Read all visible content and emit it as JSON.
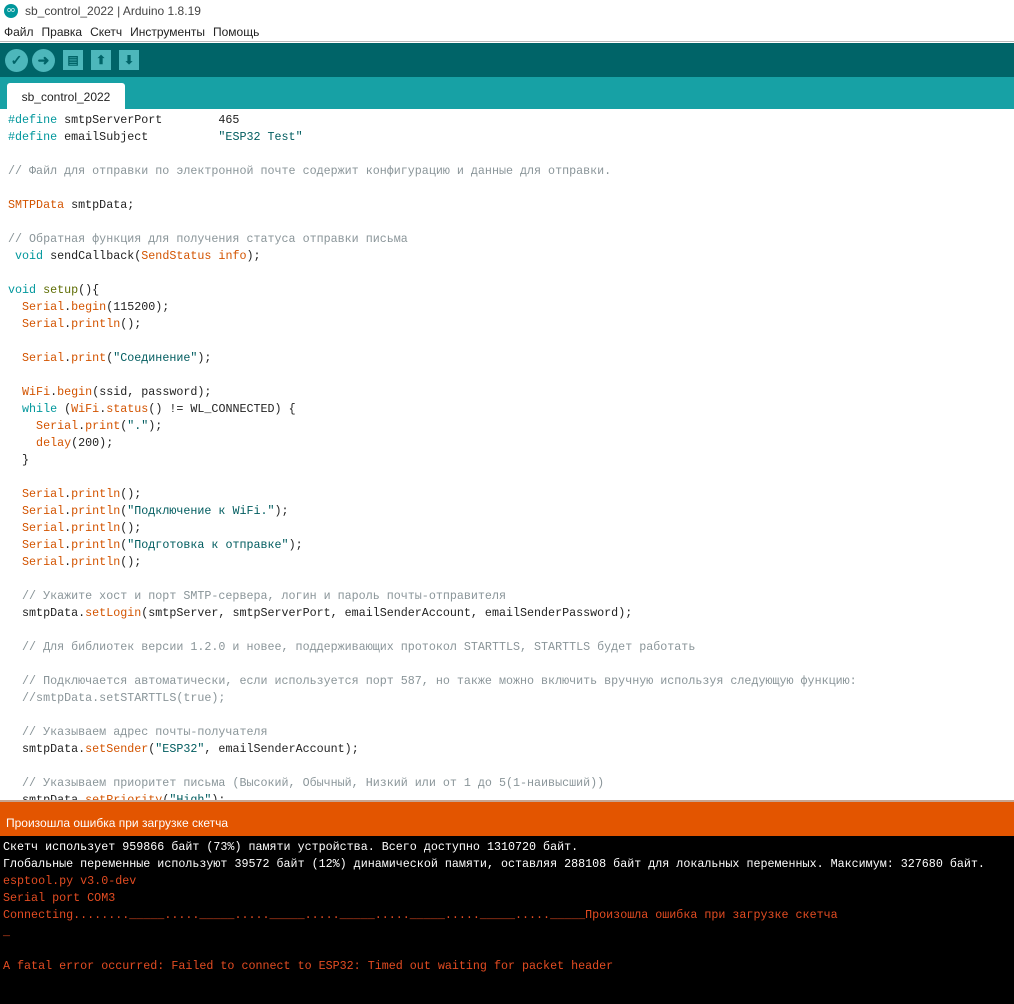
{
  "window": {
    "title": "sb_control_2022 | Arduino 1.8.19",
    "logo": "oo"
  },
  "menu": [
    "Файл",
    "Правка",
    "Скетч",
    "Инструменты",
    "Помощь"
  ],
  "toolbar": {
    "verify": "✓",
    "upload": "➜",
    "new": "▤",
    "open": "⬆",
    "save": "⬇"
  },
  "tab": {
    "label": "sb_control_2022"
  },
  "code": [
    [
      [
        "#define ",
        "k"
      ],
      [
        "smtpServerPort        465",
        "p"
      ]
    ],
    [
      [
        "#define ",
        "k"
      ],
      [
        "emailSubject          ",
        "p"
      ],
      [
        "\"ESP32 Test\"",
        "s"
      ]
    ],
    [],
    [
      [
        "// Файл для отправки по электронной почте содержит конфигурацию и данные для отправки.",
        "c"
      ]
    ],
    [],
    [
      [
        "SMTPData",
        "f"
      ],
      [
        " smtpData;",
        "p"
      ]
    ],
    [],
    [
      [
        "// Обратная функция для получения статуса отправки письма",
        "c"
      ]
    ],
    [
      [
        " void",
        "k"
      ],
      [
        " sendCallback(",
        "p"
      ],
      [
        "SendStatus info",
        "f"
      ],
      [
        ");",
        "p"
      ]
    ],
    [],
    [
      [
        "void",
        "k"
      ],
      [
        " ",
        "p"
      ],
      [
        "setup",
        "g"
      ],
      [
        "(){",
        "p"
      ]
    ],
    [
      [
        "  Serial",
        "f"
      ],
      [
        ".",
        "p"
      ],
      [
        "begin",
        "f"
      ],
      [
        "(115200);",
        "p"
      ]
    ],
    [
      [
        "  Serial",
        "f"
      ],
      [
        ".",
        "p"
      ],
      [
        "println",
        "f"
      ],
      [
        "();",
        "p"
      ]
    ],
    [],
    [
      [
        "  Serial",
        "f"
      ],
      [
        ".",
        "p"
      ],
      [
        "print",
        "f"
      ],
      [
        "(",
        "p"
      ],
      [
        "\"Соединение\"",
        "s"
      ],
      [
        ");",
        "p"
      ]
    ],
    [],
    [
      [
        "  WiFi",
        "f"
      ],
      [
        ".",
        "p"
      ],
      [
        "begin",
        "f"
      ],
      [
        "(ssid, password);",
        "p"
      ]
    ],
    [
      [
        "  while",
        "k"
      ],
      [
        " (",
        "p"
      ],
      [
        "WiFi",
        "f"
      ],
      [
        ".",
        "p"
      ],
      [
        "status",
        "f"
      ],
      [
        "() != WL_CONNECTED) {",
        "p"
      ]
    ],
    [
      [
        "    Serial",
        "f"
      ],
      [
        ".",
        "p"
      ],
      [
        "print",
        "f"
      ],
      [
        "(",
        "p"
      ],
      [
        "\".\"",
        "s"
      ],
      [
        ");",
        "p"
      ]
    ],
    [
      [
        "    delay",
        "f"
      ],
      [
        "(200);",
        "p"
      ]
    ],
    [
      [
        "  }",
        "p"
      ]
    ],
    [],
    [
      [
        "  Serial",
        "f"
      ],
      [
        ".",
        "p"
      ],
      [
        "println",
        "f"
      ],
      [
        "();",
        "p"
      ]
    ],
    [
      [
        "  Serial",
        "f"
      ],
      [
        ".",
        "p"
      ],
      [
        "println",
        "f"
      ],
      [
        "(",
        "p"
      ],
      [
        "\"Подключение к WiFi.\"",
        "s"
      ],
      [
        ");",
        "p"
      ]
    ],
    [
      [
        "  Serial",
        "f"
      ],
      [
        ".",
        "p"
      ],
      [
        "println",
        "f"
      ],
      [
        "();",
        "p"
      ]
    ],
    [
      [
        "  Serial",
        "f"
      ],
      [
        ".",
        "p"
      ],
      [
        "println",
        "f"
      ],
      [
        "(",
        "p"
      ],
      [
        "\"Подготовка к отправке\"",
        "s"
      ],
      [
        ");",
        "p"
      ]
    ],
    [
      [
        "  Serial",
        "f"
      ],
      [
        ".",
        "p"
      ],
      [
        "println",
        "f"
      ],
      [
        "();",
        "p"
      ]
    ],
    [],
    [
      [
        "  // Укажите хост и порт SMTP-сервера, логин и пароль почты-отправителя",
        "c"
      ]
    ],
    [
      [
        "  smtpData.",
        "p"
      ],
      [
        "setLogin",
        "f"
      ],
      [
        "(smtpServer, smtpServerPort, emailSenderAccount, emailSenderPassword);",
        "p"
      ]
    ],
    [],
    [
      [
        "  // Для библиотек версии 1.2.0 и новее, поддерживающих протокол STARTTLS, STARTTLS будет работать",
        "c"
      ]
    ],
    [],
    [
      [
        "  // Подключается автоматически, если используется порт 587, но также можно включить вручную используя следующую функцию:",
        "c"
      ]
    ],
    [
      [
        "  //smtpData.setSTARTTLS(true);",
        "c"
      ]
    ],
    [],
    [
      [
        "  // Указываем адрес почты-получателя",
        "c"
      ]
    ],
    [
      [
        "  smtpData.",
        "p"
      ],
      [
        "setSender",
        "f"
      ],
      [
        "(",
        "p"
      ],
      [
        "\"ESP32\"",
        "s"
      ],
      [
        ", emailSenderAccount);",
        "p"
      ]
    ],
    [],
    [
      [
        "  // Указываем приоритет письма (Высокий, Обычный, Низкий или от 1 до 5(1-наивысший))",
        "c"
      ]
    ],
    [
      [
        "  smtpData.",
        "p"
      ],
      [
        "setPriority",
        "f"
      ],
      [
        "(",
        "p"
      ],
      [
        "\"High\"",
        "s"
      ],
      [
        ");",
        "p"
      ]
    ]
  ],
  "status": {
    "message": "Произошла ошибка при загрузке скетча",
    "color": "#E35500"
  },
  "console": [
    {
      "t": "Скетч использует 959866 байт (73%) памяти устройства. Всего доступно 1310720 байт.",
      "e": false
    },
    {
      "t": "Глобальные переменные используют 39572 байт (12%) динамической памяти, оставляя 288108 байт для локальных переменных. Максимум: 327680 байт.",
      "e": false
    },
    {
      "t": "esptool.py v3.0-dev",
      "e": true
    },
    {
      "t": "Serial port COM3",
      "e": true
    },
    {
      "t": "Connecting........_____....._____....._____....._____....._____....._____....._____Произошла ошибка при загрузке скетча",
      "e": true
    },
    {
      "t": "_",
      "e": true
    },
    {
      "t": "",
      "e": true
    },
    {
      "t": "A fatal error occurred: Failed to connect to ESP32: Timed out waiting for packet header",
      "e": true
    }
  ]
}
